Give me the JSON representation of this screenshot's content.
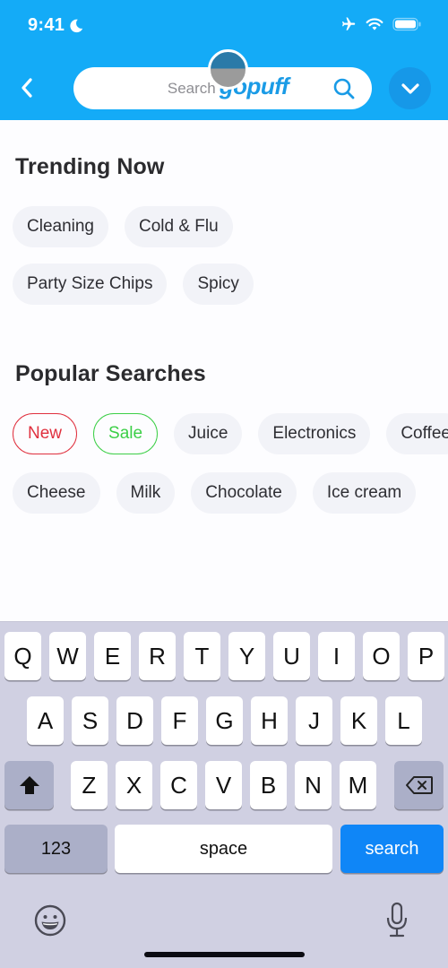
{
  "status_bar": {
    "time": "9:41",
    "icons": [
      "moon-icon",
      "airplane-icon",
      "wifi-icon",
      "battery-icon"
    ]
  },
  "header": {
    "back_icon": "chevron-left-icon",
    "search": {
      "placeholder": "Search",
      "brand": "gopuff",
      "icon": "search-icon"
    },
    "dropdown_icon": "chevron-down-icon",
    "colors": {
      "background": "#14abf7",
      "dropdown_bg": "#1698e8",
      "brand": "#1a9be6"
    }
  },
  "trending": {
    "title": "Trending Now",
    "chips": [
      [
        "Cleaning",
        "Cold & Flu"
      ],
      [
        "Party Size Chips",
        "Spicy"
      ]
    ]
  },
  "popular": {
    "title": "Popular Searches",
    "row1": [
      "New",
      "Sale",
      "Juice",
      "Electronics",
      "Coffee"
    ],
    "row2": [
      "Cheese",
      "Milk",
      "Chocolate",
      "Ice cream"
    ],
    "colors": {
      "new": "#e0303e",
      "sale": "#3ccf47"
    }
  },
  "keyboard": {
    "row1": [
      "Q",
      "W",
      "E",
      "R",
      "T",
      "Y",
      "U",
      "I",
      "O",
      "P"
    ],
    "row2": [
      "A",
      "S",
      "D",
      "F",
      "G",
      "H",
      "J",
      "K",
      "L"
    ],
    "row3": [
      "Z",
      "X",
      "C",
      "V",
      "B",
      "N",
      "M"
    ],
    "numbers_label": "123",
    "space_label": "space",
    "search_label": "search",
    "shift_icon": "shift-icon",
    "delete_icon": "backspace-icon",
    "emoji_icon": "emoji-icon",
    "mic_icon": "microphone-icon",
    "colors": {
      "background": "#d0d0e2",
      "search_key": "#0f86f7"
    }
  }
}
